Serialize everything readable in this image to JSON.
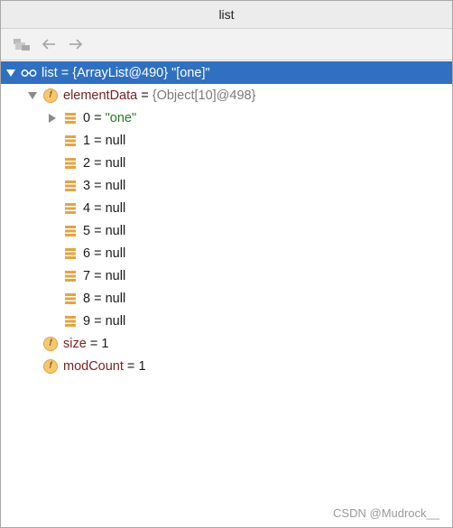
{
  "window": {
    "title": "list"
  },
  "tree": {
    "root": {
      "name": "list",
      "eq": " = ",
      "ref": "{ArrayList@490}",
      "value": " \"[one]\""
    },
    "elementData": {
      "name": "elementData",
      "eq": " = ",
      "ref": "{Object[10]@498}"
    },
    "elements": [
      {
        "index": "0",
        "eq": " = ",
        "value": "\"one\""
      },
      {
        "index": "1",
        "eq": " = ",
        "value": "null"
      },
      {
        "index": "2",
        "eq": " = ",
        "value": "null"
      },
      {
        "index": "3",
        "eq": " = ",
        "value": "null"
      },
      {
        "index": "4",
        "eq": " = ",
        "value": "null"
      },
      {
        "index": "5",
        "eq": " = ",
        "value": "null"
      },
      {
        "index": "6",
        "eq": " = ",
        "value": "null"
      },
      {
        "index": "7",
        "eq": " = ",
        "value": "null"
      },
      {
        "index": "8",
        "eq": " = ",
        "value": "null"
      },
      {
        "index": "9",
        "eq": " = ",
        "value": "null"
      }
    ],
    "size": {
      "name": "size",
      "eq": " = ",
      "value": "1"
    },
    "modCount": {
      "name": "modCount",
      "eq": " = ",
      "value": "1"
    }
  },
  "field_badge": "f",
  "watermark": "CSDN @Mudrock__"
}
